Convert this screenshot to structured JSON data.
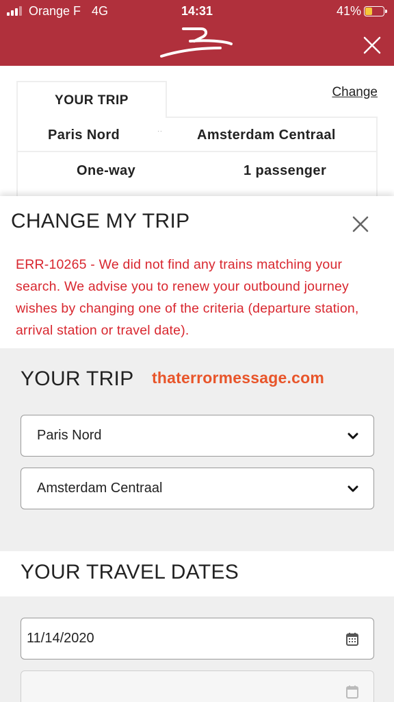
{
  "status_bar": {
    "carrier": "Orange F",
    "network": "4G",
    "time": "14:31",
    "battery": "41%",
    "battery_level": 0.41,
    "battery_color": "#f5c83a"
  },
  "header": {
    "background": "#b0303c",
    "logo_icon": "train-logo-icon",
    "close_icon": "close-icon"
  },
  "summary": {
    "tab_label": "YOUR TRIP",
    "change_link": "Change",
    "from": "Paris Nord",
    "separator": "··",
    "to": "Amsterdam Centraal",
    "trip_type": "One-way",
    "passengers": "1 passenger"
  },
  "change_panel": {
    "title": "CHANGE MY TRIP",
    "close_icon": "close-icon",
    "error_color": "#d8262e",
    "error": "ERR-10265 - We did not find any trains matching your search. We advise you to renew your outbound journey wishes by changing one of the criteria (departure station, arrival station or travel date).",
    "trip_section": {
      "title": "YOUR TRIP",
      "watermark": "thaterrormessage.com",
      "from_select": "Paris Nord",
      "to_select": "Amsterdam Centraal",
      "chevron_icon": "chevron-down-icon"
    },
    "dates_section": {
      "title": "YOUR TRAVEL DATES",
      "outbound_date": "11/14/2020",
      "return_date": "",
      "calendar_icon": "calendar-icon"
    }
  }
}
